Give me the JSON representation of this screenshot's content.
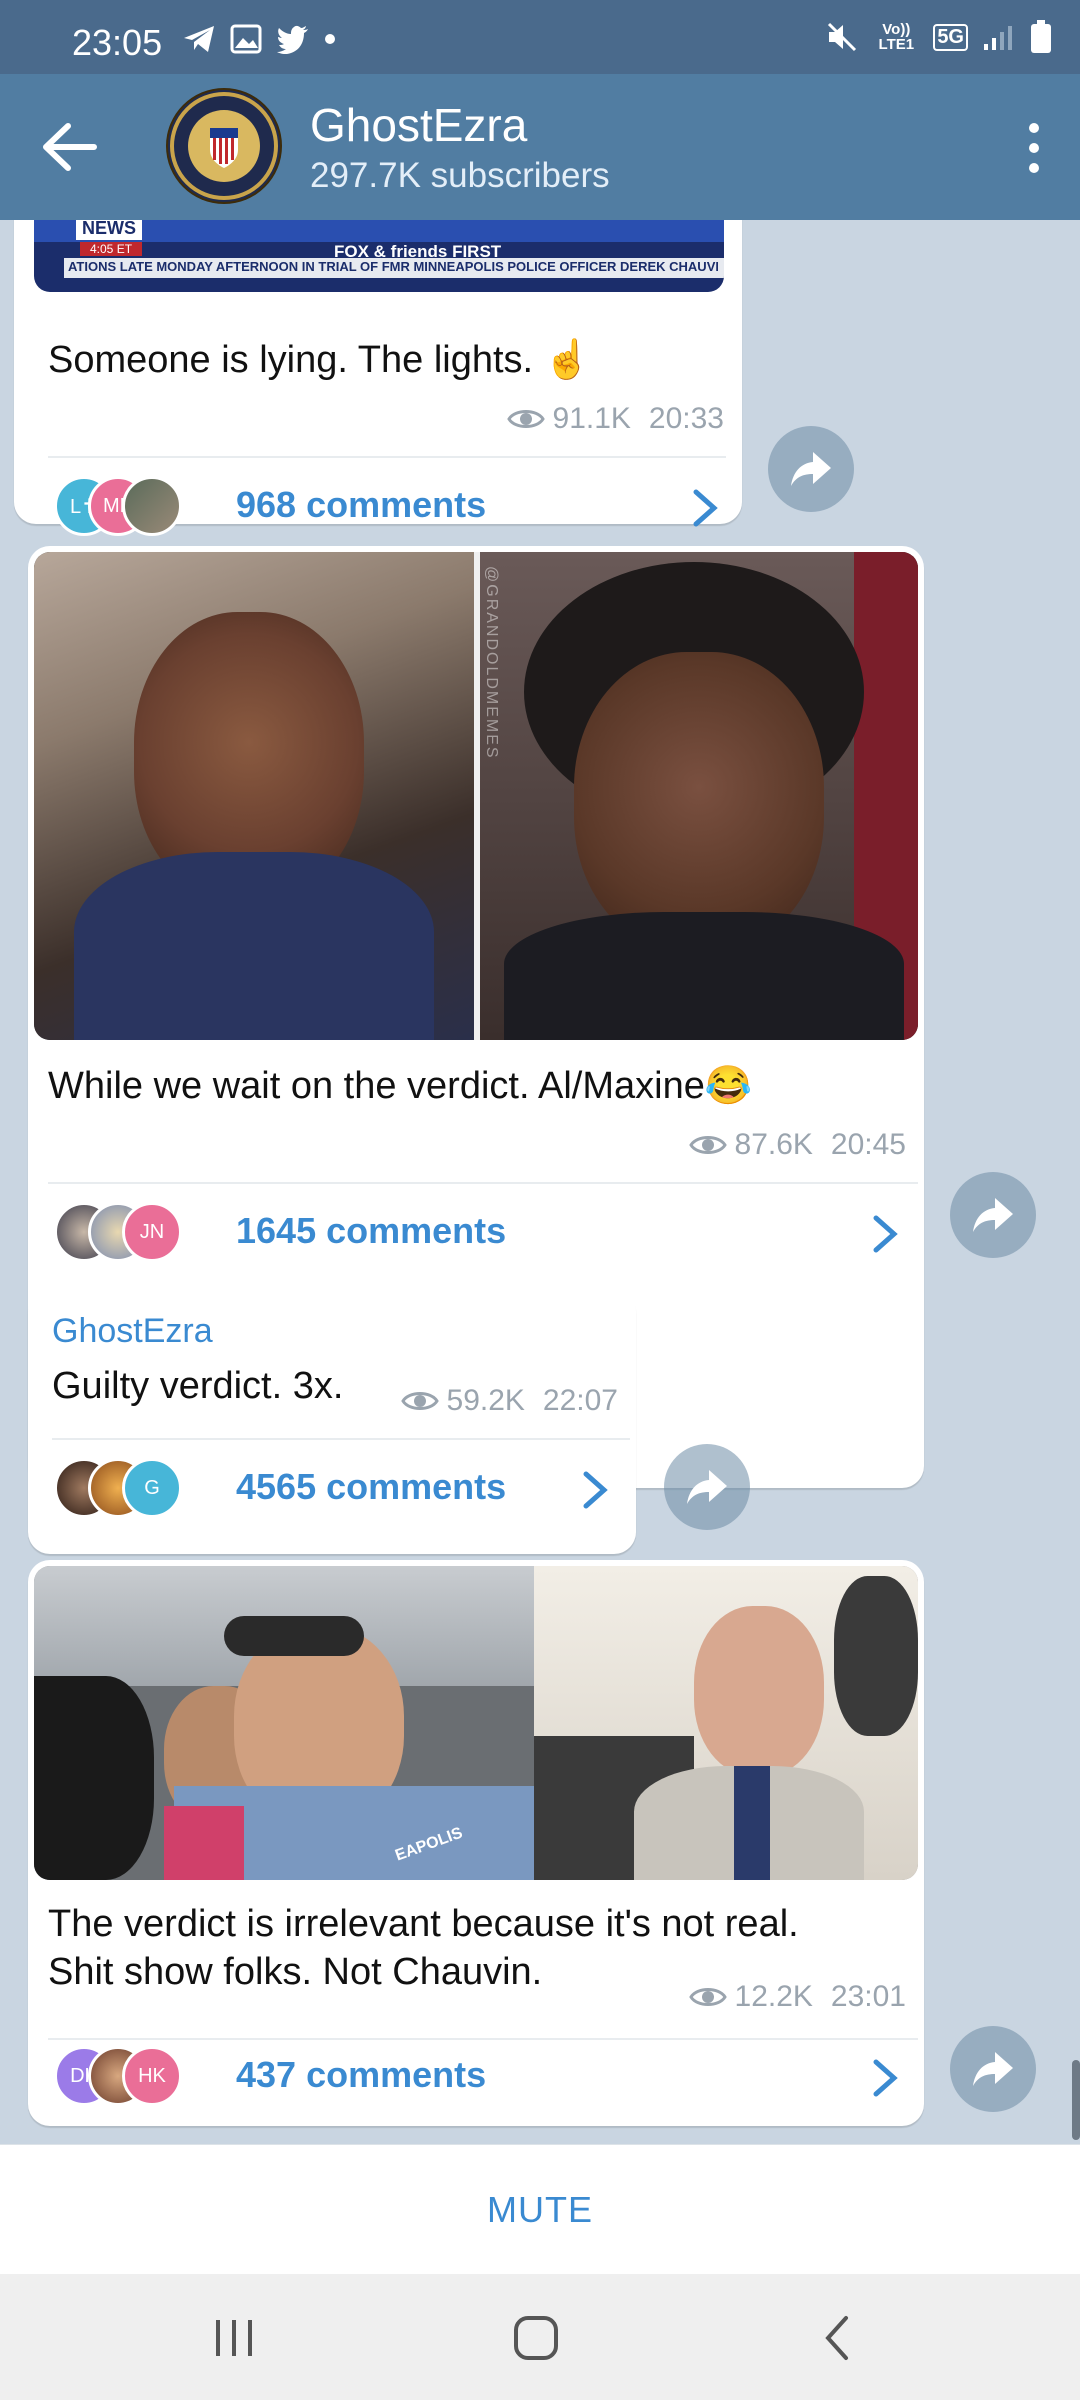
{
  "status_bar": {
    "time": "23:05",
    "left_icons": [
      "telegram-icon",
      "gallery-icon",
      "twitter-icon",
      "dot-icon"
    ],
    "right_icons": [
      "mute-icon",
      "volte-icon",
      "5g-icon",
      "signal-icon",
      "battery-icon"
    ],
    "volte_label": "Vo)) LTE1",
    "net_label": "5G"
  },
  "header": {
    "title": "GhostEzra",
    "subtitle": "297.7K subscribers"
  },
  "messages": [
    {
      "text": "Someone is lying. The lights. ☝",
      "views": "91.1K",
      "time": "20:33",
      "comments": "968 comments",
      "avatars": [
        "L✝",
        "MK",
        ""
      ],
      "media_caption_banner": "FOX & friends FIRST",
      "media_ticker": "ATIONS LATE MONDAY AFTERNOON IN TRIAL OF FMR MINNEAPOLIS POLICE OFFICER DEREK CHAUVIN, WH",
      "media_news_tag": "NEWS",
      "media_news_time": "4:05 ET"
    },
    {
      "text": "While we wait on the verdict. Al/Maxine😂",
      "views": "87.6K",
      "time": "20:45",
      "comments": "1645 comments",
      "avatars": [
        "",
        "",
        "JN"
      ],
      "media_watermark": "@GRANDOLDMEMES"
    },
    {
      "sender": "GhostEzra",
      "text": "Guilty verdict. 3x.",
      "views": "59.2K",
      "time": "22:07",
      "comments": "4565 comments",
      "avatars": [
        "",
        "",
        "G"
      ]
    },
    {
      "text_line1": "The verdict is irrelevant because it's not real.",
      "text_line2": "Shit show folks. Not Chauvin.",
      "views": "12.2K",
      "time": "23:01",
      "comments": "437 comments",
      "avatars": [
        "DK",
        "",
        "HK"
      ],
      "media_badge": "EAPOLIS"
    }
  ],
  "bottom": {
    "mute_label": "MUTE"
  },
  "colors": {
    "header_bg": "#517da2",
    "accent": "#3a8ad1",
    "chat_bg": "#c9d5e1"
  }
}
